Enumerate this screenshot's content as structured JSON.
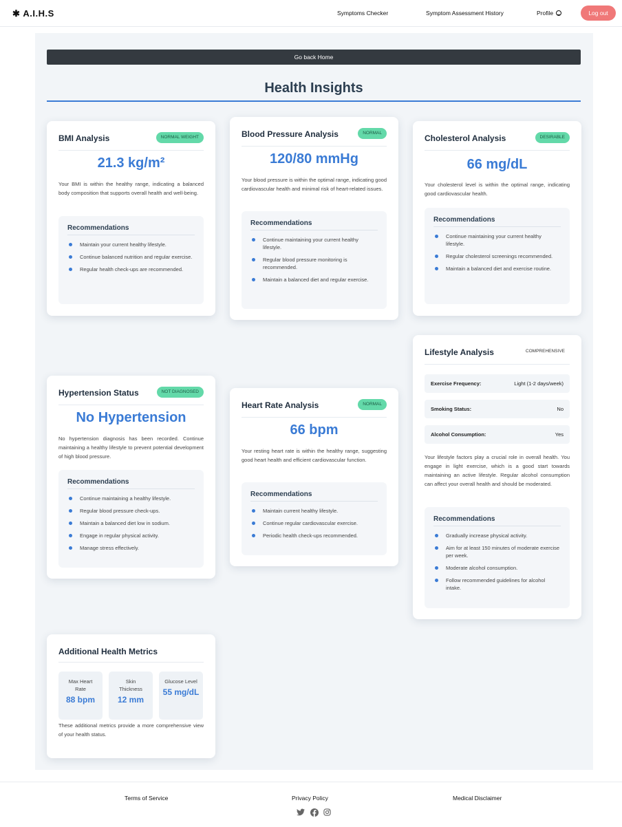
{
  "nav": {
    "brand": "A.I.H.S",
    "brand_icon": "asterisk-icon",
    "links": [
      "Symptoms Checker",
      "Symptom Assessment History",
      "Profile"
    ],
    "logout": "Log out",
    "logout_color": "#f07878"
  },
  "back_button": "Go back Home",
  "page_title": "Health Insights",
  "accent_color": "#3a7bd5",
  "badge_color": "#63d9a9",
  "bmi": {
    "title": "BMI Analysis",
    "badge": "NORMAL WEIGHT",
    "value": "21.3 kg/m²",
    "description": "Your BMI is within the healthy range, indicating a balanced body composition that supports overall health and well-being.",
    "rec_title": "Recommendations",
    "recs": [
      "Maintain your current healthy lifestyle.",
      "Continue balanced nutrition and regular exercise.",
      "Regular health check-ups are recommended."
    ]
  },
  "bp": {
    "title": "Blood Pressure Analysis",
    "badge": "NORMAL",
    "value": "120/80 mmHg",
    "description": "Your blood pressure is within the optimal range, indicating good cardiovascular health and minimal risk of heart-related issues.",
    "rec_title": "Recommendations",
    "recs": [
      "Continue maintaining your current healthy lifestyle.",
      "Regular blood pressure monitoring is recommended.",
      "Maintain a balanced diet and regular exercise."
    ]
  },
  "chol": {
    "title": "Cholesterol Analysis",
    "badge": "DESIRABLE",
    "value": "66 mg/dL",
    "description": "Your cholesterol level is within the optimal range, indicating good cardiovascular health.",
    "rec_title": "Recommendations",
    "recs": [
      "Continue maintaining your current healthy lifestyle.",
      "Regular cholesterol screenings recommended.",
      "Maintain a balanced diet and exercise routine."
    ]
  },
  "hyp": {
    "title": "Hypertension Status",
    "badge": "NOT DIAGNOSED",
    "value": "No Hypertension",
    "description": "No hypertension diagnosis has been recorded. Continue maintaining a healthy lifestyle to prevent potential development of high blood pressure.",
    "rec_title": "Recommendations",
    "recs": [
      "Continue maintaining a healthy lifestyle.",
      "Regular blood pressure check-ups.",
      "Maintain a balanced diet low in sodium.",
      "Engage in regular physical activity.",
      "Manage stress effectively."
    ]
  },
  "hr": {
    "title": "Heart Rate Analysis",
    "badge": "NORMAL",
    "value": "66 bpm",
    "description": "Your resting heart rate is within the healthy range, suggesting good heart health and efficient cardiovascular function.",
    "rec_title": "Recommendations",
    "recs": [
      "Maintain current healthy lifestyle.",
      "Continue regular cardiovascular exercise.",
      "Periodic health check-ups recommended."
    ]
  },
  "life": {
    "title": "Lifestyle Analysis",
    "badge": "COMPREHENSIVE",
    "rows": [
      {
        "label": "Exercise Frequency:",
        "value": "Light (1-2 days/week)"
      },
      {
        "label": "Smoking Status:",
        "value": "No"
      },
      {
        "label": "Alcohol Consumption:",
        "value": "Yes"
      }
    ],
    "description": "Your lifestyle factors play a crucial role in overall health. You engage in light exercise, which is a good start towards maintaining an active lifestyle. Regular alcohol consumption can affect your overall health and should be moderated.",
    "rec_title": "Recommendations",
    "recs": [
      "Gradually increase physical activity.",
      "Aim for at least 150 minutes of moderate exercise per week.",
      "Moderate alcohol consumption.",
      "Follow recommended guidelines for alcohol intake."
    ]
  },
  "metrics": {
    "title": "Additional Health Metrics",
    "items": [
      {
        "label": "Max Heart Rate",
        "value": "88 bpm"
      },
      {
        "label": "Skin Thickness",
        "value": "12 mm"
      },
      {
        "label": "Glucose Level",
        "value": "55 mg/dL"
      }
    ],
    "description": "These additional metrics provide a more comprehensive view of your health status."
  },
  "footer": {
    "links": [
      "Terms of Service",
      "Privacy Policy",
      "Medical Disclaimer"
    ],
    "social_icons": [
      "twitter-icon",
      "facebook-icon",
      "instagram-icon"
    ]
  }
}
